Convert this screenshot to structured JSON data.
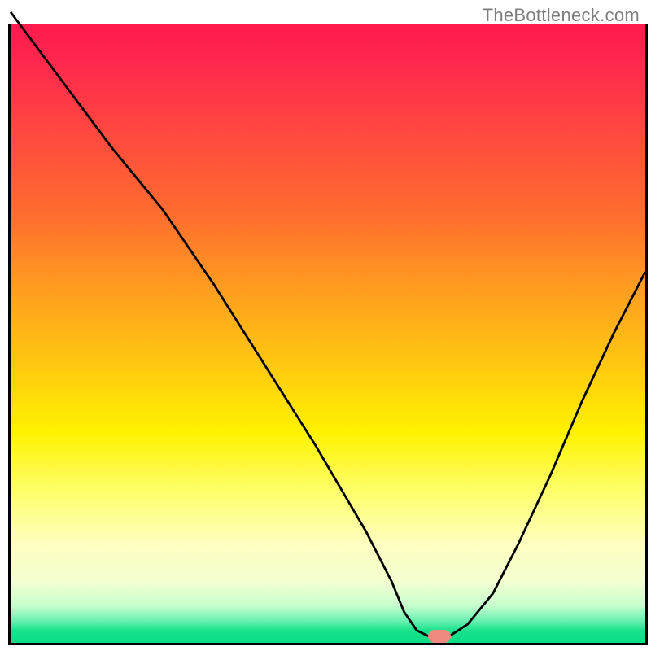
{
  "watermark": "TheBottleneck.com",
  "chart_data": {
    "type": "line",
    "title": "",
    "xlabel": "",
    "ylabel": "",
    "xlim": [
      0,
      100
    ],
    "ylim": [
      0,
      100
    ],
    "x": [
      0,
      8,
      16,
      24,
      32,
      40,
      48,
      56,
      60,
      62,
      64,
      66,
      69,
      72,
      76,
      80,
      85,
      90,
      95,
      100
    ],
    "values": [
      102,
      91,
      80,
      70,
      58,
      45,
      32,
      18,
      10,
      5,
      2,
      1,
      1,
      3,
      8,
      16,
      27,
      39,
      50,
      60
    ],
    "marker": {
      "x": 67.5,
      "y": 1
    },
    "colors": {
      "top": "#ff1d50",
      "mid": "#ffe500",
      "bottom": "#0bdc86",
      "line": "#000000",
      "marker": "#ef8a80"
    }
  }
}
